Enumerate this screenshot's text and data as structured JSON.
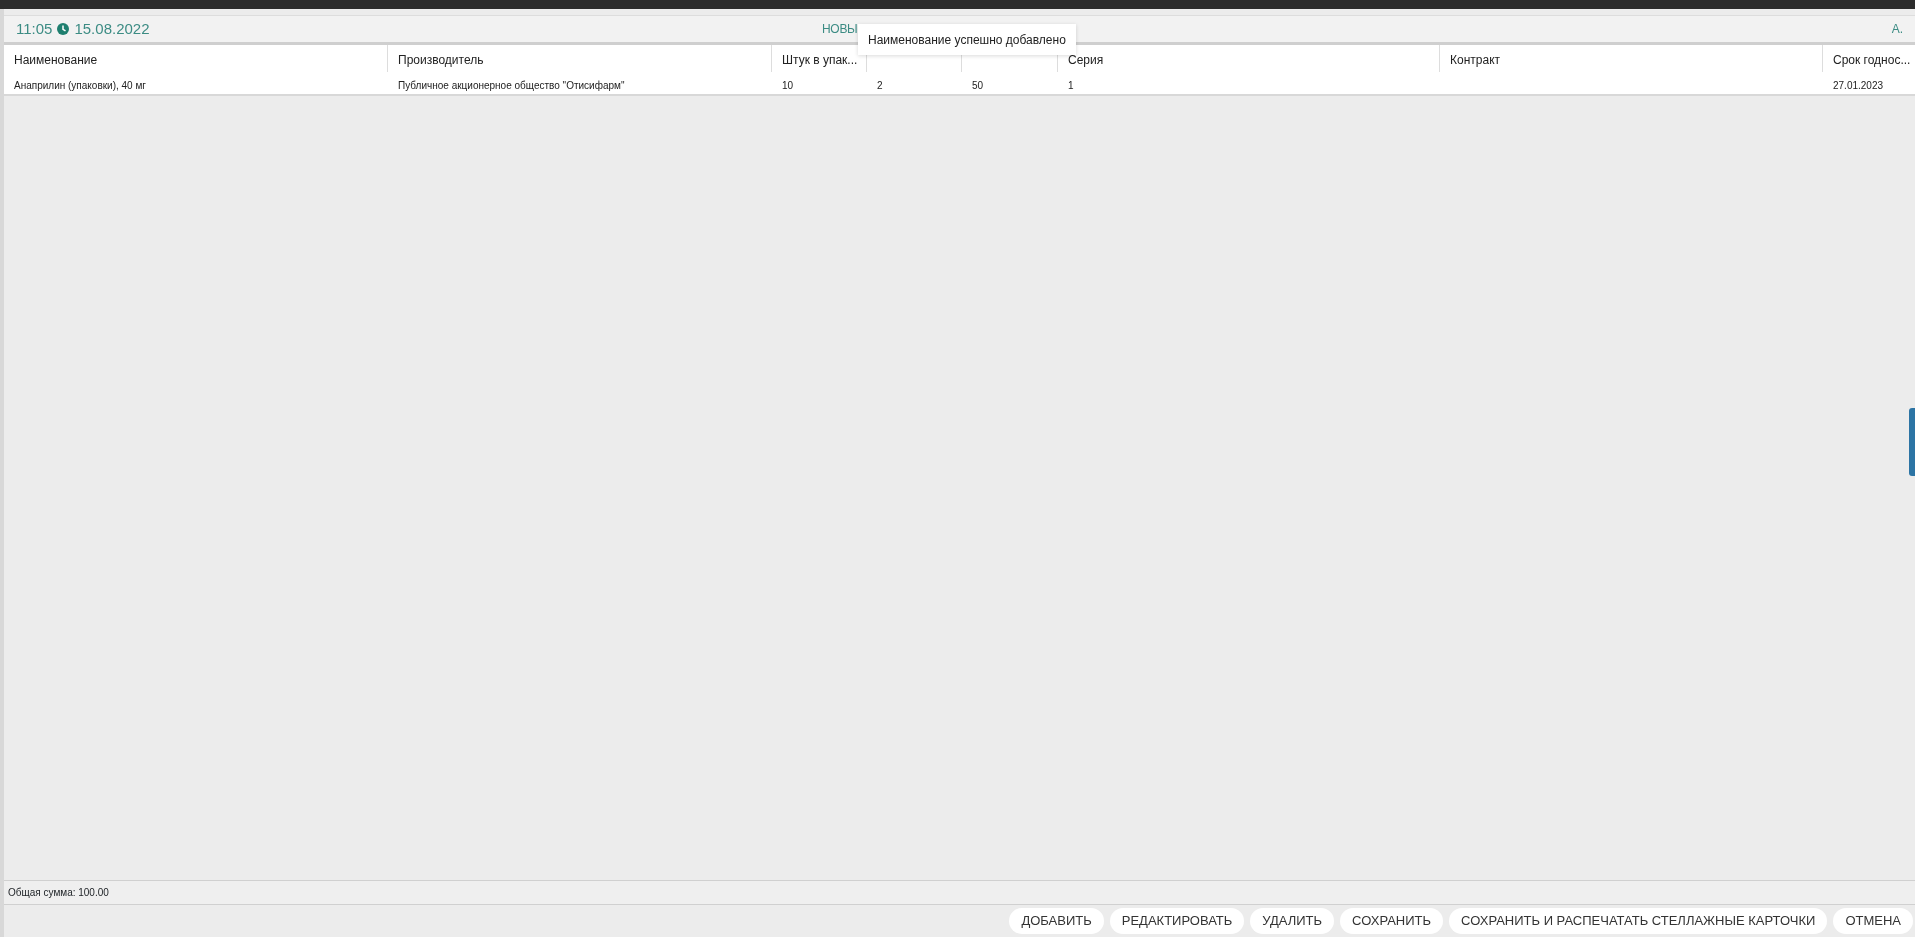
{
  "header": {
    "time": "11:05",
    "date": "15.08.2022",
    "title": "НОВЫ",
    "user": "А."
  },
  "table": {
    "columns": [
      "Наименование",
      "Производитель",
      "Штук в упак...",
      "",
      "",
      "Серия",
      "Контракт",
      "Срок годнос..."
    ],
    "rows": [
      [
        "Анаприлин (упаковки), 40 мг",
        "Публичное акционерное общество \"Отисифарм\"",
        "10",
        "2",
        "50",
        "1",
        "",
        "27.01.2023"
      ]
    ]
  },
  "toast": "Наименование успешно добавлено",
  "footer": {
    "total": "Общая сумма: 100.00"
  },
  "buttons": [
    "ДОБАВИТЬ",
    "РЕДАКТИРОВАТЬ",
    "УДАЛИТЬ",
    "СОХРАНИТЬ",
    "СОХРАНИТЬ И РАСПЕЧАТАТЬ СТЕЛЛАЖНЫЕ КАРТОЧКИ",
    "ОТМЕНА"
  ]
}
